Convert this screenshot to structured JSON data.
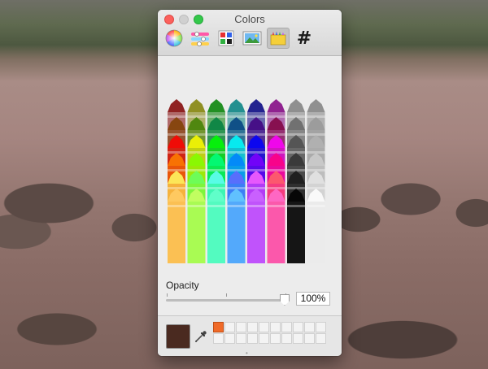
{
  "window": {
    "title": "Colors"
  },
  "toolbar": {
    "modes": [
      {
        "icon": "color-wheel-icon"
      },
      {
        "icon": "color-sliders-icon"
      },
      {
        "icon": "color-palettes-icon"
      },
      {
        "icon": "image-palettes-icon"
      },
      {
        "icon": "crayons-icon",
        "selected": true
      },
      {
        "icon": "hex-icon",
        "glyph": "#"
      }
    ]
  },
  "crayons": {
    "rows": [
      [
        "#800000",
        "#808000",
        "#008000",
        "#008080",
        "#000080",
        "#800080",
        "#7f7f7f",
        "#808080"
      ],
      [
        "#804000",
        "#408000",
        "#008040",
        "#004080",
        "#400080",
        "#800040",
        "#666666",
        "#999999"
      ],
      [
        "#ff0000",
        "#ffff00",
        "#00ff00",
        "#00ffff",
        "#0000ff",
        "#ff00ff",
        "#4c4c4c",
        "#b3b3b3"
      ],
      [
        "#ff8000",
        "#80ff00",
        "#00ff80",
        "#0080ff",
        "#8000ff",
        "#ff0080",
        "#333333",
        "#cccccc"
      ],
      [
        "#ffff66",
        "#66ff66",
        "#66ffff",
        "#6666ff",
        "#ff66ff",
        "#ff6666",
        "#191919",
        "#e6e6e6"
      ],
      [
        "#ffcc66",
        "#ccff66",
        "#66ffcc",
        "#66ccff",
        "#cc66ff",
        "#ff6fcf",
        "#000000",
        "#ffffff"
      ]
    ]
  },
  "opacity": {
    "label": "Opacity",
    "value": "100%",
    "level": 1.0
  },
  "current_color": "#4a2a20",
  "swatches": {
    "filled": [
      "#f06a28"
    ]
  }
}
